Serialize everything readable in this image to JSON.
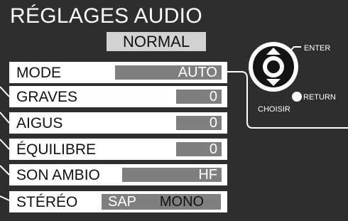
{
  "title": "RÉGLAGES AUDIO",
  "preset": "NORMAL",
  "rows": [
    {
      "label": "MODE",
      "value": "AUTO"
    },
    {
      "label": "GRAVES",
      "value": "0"
    },
    {
      "label": "AIGUS",
      "value": "0"
    },
    {
      "label": "ÉQUILIBRE",
      "value": "0"
    },
    {
      "label": "SON AMBIO",
      "value": "HF"
    }
  ],
  "stereo": {
    "label": "STÉRÉO",
    "options": [
      "SAP",
      "MONO"
    ],
    "selected": "MONO"
  },
  "remote": {
    "enter_label": "ENTER",
    "return_label": "RETURN",
    "choose_label": "CHOISIR"
  }
}
